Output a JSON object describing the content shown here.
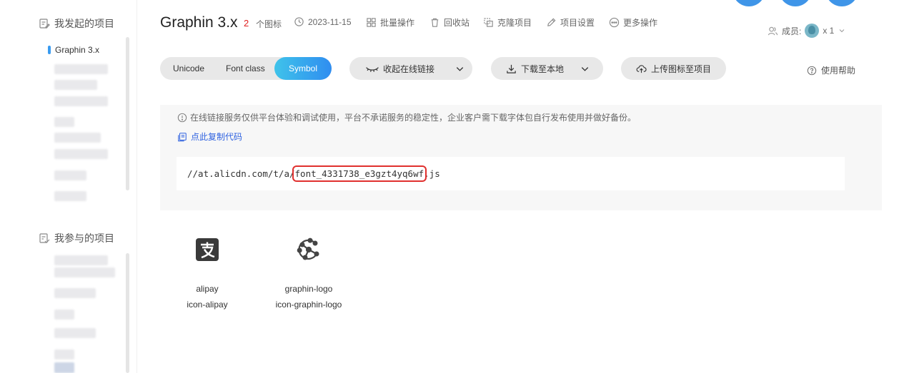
{
  "sidebar": {
    "my_projects_label": "我发起的项目",
    "joined_projects_label": "我参与的项目",
    "active_project": "Graphin 3.x"
  },
  "header": {
    "project_title": "Graphin 3.x",
    "icon_count": "2",
    "icon_count_label": "个图标",
    "date": "2023-11-15",
    "actions": {
      "batch": "批量操作",
      "recycle": "回收站",
      "clone": "克隆项目",
      "settings": "项目设置",
      "more": "更多操作"
    },
    "members_label": "成员:",
    "members_count": "x 1"
  },
  "tabs": {
    "unicode": "Unicode",
    "font_class": "Font class",
    "symbol": "Symbol"
  },
  "buttons": {
    "collapse_link": "收起在线链接",
    "download": "下载至本地",
    "upload": "上传图标至项目",
    "help": "使用帮助"
  },
  "notice": {
    "text": "在线链接服务仅供平台体验和调试使用，平台不承诺服务的稳定性，企业客户需下载字体包自行发布使用并做好备份。",
    "copy_code": "点此复制代码"
  },
  "url": {
    "prefix": "//at.alicdn.com/t/a/",
    "highlight": "font_4331738_e3gzt4yq6wf",
    "suffix": ".js"
  },
  "icons": [
    {
      "name": "alipay",
      "class": "icon-alipay",
      "icon": "alipay-icon"
    },
    {
      "name": "graphin-logo",
      "class": "icon-graphin-logo",
      "icon": "graphin-logo-icon"
    }
  ],
  "colors": {
    "accent_gradient_start": "#3fc3ea",
    "accent_gradient_end": "#2f8df0",
    "highlight_border": "#e0302e",
    "link": "#2f62e0",
    "count": "#e02020"
  }
}
